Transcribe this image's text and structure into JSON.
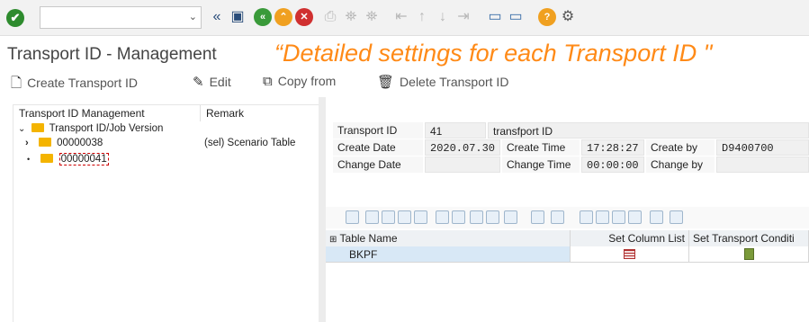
{
  "toolbar": {
    "check_icon": "check-icon",
    "command_field_value": "",
    "accent_green": "#2e8b2e"
  },
  "title": "Transport ID - Management",
  "annotation": "“Detailed settings for each Transport ID  \"",
  "actions": {
    "create": "Create Transport ID",
    "edit": "Edit",
    "copy": "Copy from",
    "delete": "Delete Transport ID"
  },
  "tree": {
    "col_management": "Transport ID Management",
    "col_remark": "Remark",
    "root": "Transport ID/Job Version",
    "nodes": [
      {
        "id": "00000038",
        "remark": "(sel) Scenario Table"
      },
      {
        "id": "00000041",
        "remark": ""
      }
    ]
  },
  "form": {
    "transport_id_label": "Transport ID",
    "transport_id_value": "41",
    "transport_id_desc": "transfport ID",
    "create_date_label": "Create Date",
    "create_date_value": "2020.07.30",
    "create_time_label": "Create Time",
    "create_time_value": "17:28:27",
    "create_by_label": "Create by",
    "create_by_value": "D9400700",
    "change_date_label": "Change Date",
    "change_date_value": "",
    "change_time_label": "Change Time",
    "change_time_value": "00:00:00",
    "change_by_label": "Change by",
    "change_by_value": ""
  },
  "table": {
    "headers": [
      "Table Name",
      "Set Column List",
      "Set Transport Conditi"
    ],
    "rows": [
      {
        "table_name": "BKPF"
      }
    ]
  }
}
